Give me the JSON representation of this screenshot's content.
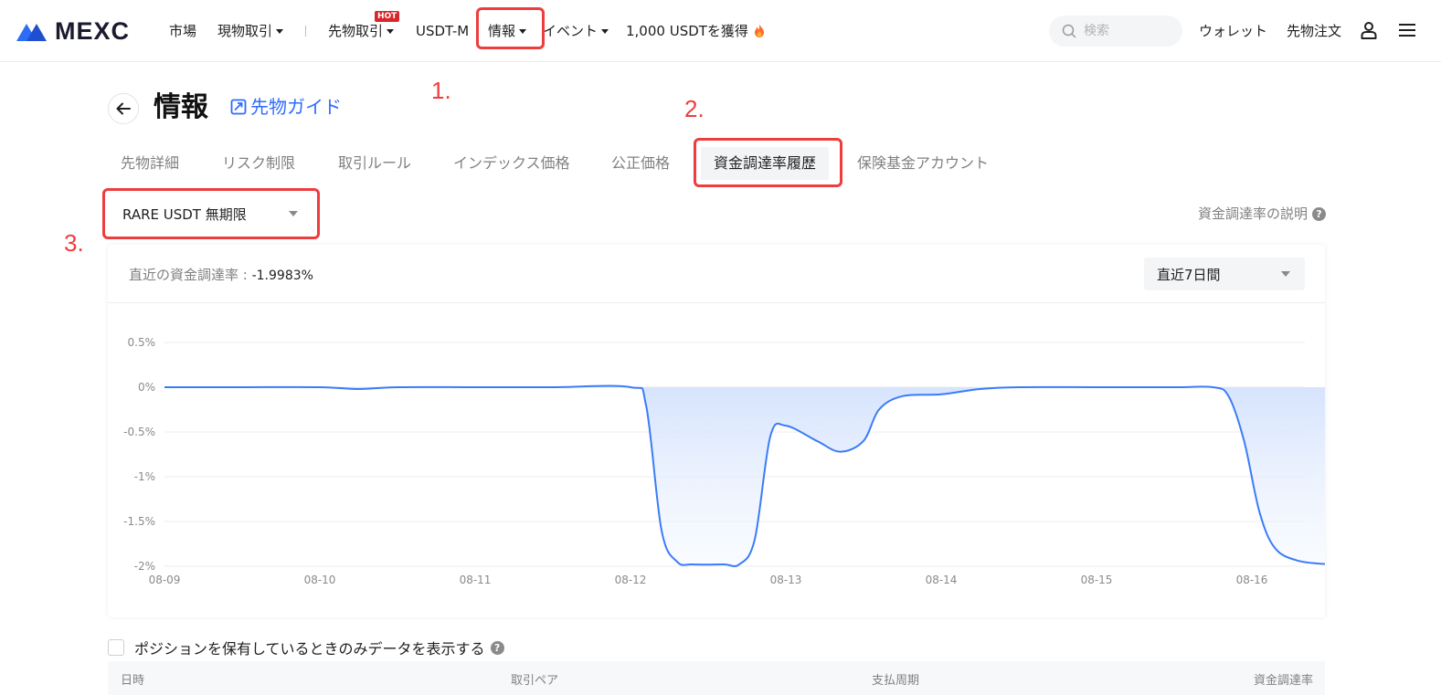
{
  "brand": {
    "name": "MEXC",
    "colors": {
      "logo_blue": "#2d6df6",
      "accent": "#2f6bff",
      "annotation": "#ee3d3d",
      "hot": "#d9262c"
    }
  },
  "nav": {
    "market": "市場",
    "spot": "現物取引",
    "futures": "先物取引",
    "hot_badge": "HOT",
    "usdt_m": "USDT-M",
    "info": "情報",
    "events": "イベント",
    "promo": "1,000 USDTを獲得"
  },
  "search": {
    "placeholder": "検索"
  },
  "header_right": {
    "wallet": "ウォレット",
    "futures_orders": "先物注文"
  },
  "page": {
    "title": "情報",
    "guide_link": "先物ガイド"
  },
  "tabs": [
    {
      "label": "先物詳細"
    },
    {
      "label": "リスク制限"
    },
    {
      "label": "取引ルール"
    },
    {
      "label": "インデックス価格"
    },
    {
      "label": "公正価格"
    },
    {
      "label": "資金調達率履歴",
      "active": true
    },
    {
      "label": "保険基金アカウント"
    }
  ],
  "annotations": {
    "n1": "1.",
    "n2": "2.",
    "n3": "3."
  },
  "symbol_select": {
    "value": "RARE USDT 無期限"
  },
  "explain_link": "資金調達率の説明",
  "card": {
    "latest_label": "直近の資金調達率 : ",
    "latest_value": "-1.9983%",
    "period": "直近7日間"
  },
  "chart_data": {
    "type": "area",
    "title": "",
    "xlabel": "",
    "ylabel": "",
    "ylim": [
      -2,
      0.5
    ],
    "y_ticks": [
      "0.5%",
      "0%",
      "-0.5%",
      "-1%",
      "-1.5%",
      "-2%"
    ],
    "y_tick_values": [
      0.5,
      0,
      -0.5,
      -1,
      -1.5,
      -2
    ],
    "x_ticks": [
      "08-09",
      "08-10",
      "08-11",
      "08-12",
      "08-13",
      "08-14",
      "08-15",
      "08-16"
    ],
    "grid": true,
    "line_color": "#3b7cf6",
    "fill_color": "#dbe7fd",
    "series": [
      {
        "values": [
          [
            0,
            0
          ],
          [
            0.5,
            0
          ],
          [
            1,
            0
          ],
          [
            1.25,
            -0.02
          ],
          [
            1.5,
            0
          ],
          [
            2,
            0
          ],
          [
            2.5,
            0
          ],
          [
            3,
            0
          ],
          [
            3.1,
            -0.2
          ],
          [
            3.2,
            -1.6
          ],
          [
            3.3,
            -1.95
          ],
          [
            3.4,
            -1.98
          ],
          [
            3.6,
            -1.98
          ],
          [
            3.7,
            -1.98
          ],
          [
            3.8,
            -1.7
          ],
          [
            3.9,
            -0.55
          ],
          [
            4.0,
            -0.43
          ],
          [
            4.2,
            -0.6
          ],
          [
            4.35,
            -0.72
          ],
          [
            4.5,
            -0.6
          ],
          [
            4.6,
            -0.25
          ],
          [
            4.75,
            -0.1
          ],
          [
            5.0,
            -0.08
          ],
          [
            5.25,
            -0.02
          ],
          [
            5.5,
            0
          ],
          [
            6.0,
            0
          ],
          [
            6.5,
            0
          ],
          [
            6.75,
            0
          ],
          [
            6.85,
            -0.1
          ],
          [
            6.95,
            -0.6
          ],
          [
            7.05,
            -1.4
          ],
          [
            7.15,
            -1.8
          ],
          [
            7.3,
            -1.94
          ],
          [
            7.5,
            -1.98
          ],
          [
            7.55,
            -1.9983
          ]
        ]
      }
    ]
  },
  "position_only_label": "ポジションを保有しているときのみデータを表示する",
  "table": {
    "columns": [
      "日時",
      "取引ペア",
      "支払周期",
      "資金調達率"
    ]
  }
}
